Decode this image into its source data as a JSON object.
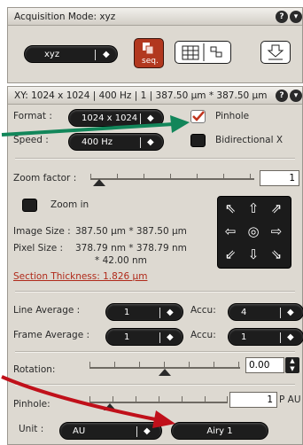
{
  "acquisition": {
    "title": "Acquisition Mode: xyz",
    "mode_value": "xyz",
    "seq_label": "seq."
  },
  "xy_panel": {
    "title": "XY: 1024 x 1024 | 400 Hz | 1 | 387.50 µm * 387.50 µm",
    "format_label": "Format :",
    "format_value": "1024 x 1024",
    "pinhole_checkbox_label": "Pinhole",
    "speed_label": "Speed :",
    "speed_value": "400 Hz",
    "bidirectional_label": "Bidirectional X",
    "zoom_factor_label": "Zoom factor :",
    "zoom_value": "1",
    "zoom_in_label": "Zoom in",
    "image_size_label": "Image Size :",
    "image_size_value": "387.50 µm * 387.50 µm",
    "pixel_size_label": "Pixel Size :",
    "pixel_size_value_1": "378.79 nm * 378.79 nm",
    "pixel_size_value_2": "* 42.00 nm",
    "section_thickness": "Section Thickness: 1.826 µm",
    "line_average_label": "Line Average :",
    "line_average_value": "1",
    "accu_label": "Accu:",
    "line_accu_value": "4",
    "frame_average_label": "Frame Average :",
    "frame_average_value": "1",
    "frame_accu_value": "1",
    "rotation_label": "Rotation:",
    "rotation_value": "0.00",
    "pinhole_label": "Pinhole:",
    "pinhole_value": "1",
    "pinhole_unit": "P AU",
    "unit_label": "Unit :",
    "unit_value": "AU",
    "airy_button_label": "Airy 1"
  },
  "colors": {
    "green_arrow": "#12865a",
    "red_arrow": "#c0101a",
    "seq_button": "#b2381f",
    "checkbox_check": "#c0341d"
  }
}
